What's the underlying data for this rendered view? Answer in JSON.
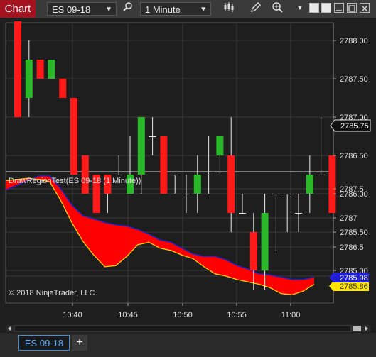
{
  "toolbar": {
    "chart_label": "Chart",
    "instrument": "ES 09-18",
    "interval": "1 Minute",
    "icons": [
      "search-icon",
      "bar-type-icon",
      "pencil-icon",
      "zoom-icon",
      "dropdown-icon",
      "window-tile-icon",
      "minimize-icon",
      "maximize-icon",
      "close-icon"
    ]
  },
  "price_panel": {
    "y_ticks": [
      "2788.00",
      "2787.50",
      "2787.00",
      "2786.50",
      "2786.00",
      "2785.50",
      "2785.00"
    ],
    "last_price_label": "2785.75"
  },
  "indicator_panel": {
    "title": "DrawRegionTest(ES 09-18 (1 Minute))",
    "y_ticks": [
      "2787.5",
      "2787",
      "2786.5",
      "2786"
    ],
    "blue_value_label": "2785.98",
    "yellow_value_label": "2785.86",
    "copyright": "© 2018 NinjaTrader, LLC"
  },
  "x_axis": {
    "ticks": [
      "10:40",
      "10:45",
      "10:50",
      "10:55",
      "11:00"
    ]
  },
  "status": {
    "tab_label": "ES 09-18",
    "add_tab_label": "+"
  },
  "colors": {
    "up": "#2ab82a",
    "down": "#ff1a1a",
    "region": "#ff0000",
    "blue_line": "#2222cc",
    "yellow_line": "#ffd200",
    "chart_tab": "#a3121f"
  },
  "chart_data": [
    {
      "type": "candlestick",
      "title": "ES 09-18",
      "x_axis": "time (1 minute)",
      "ylim": [
        2784.75,
        2788.25
      ],
      "candles": [
        {
          "o": 2788.25,
          "h": 2788.25,
          "l": 2787.0,
          "c": 2787.0
        },
        {
          "o": 2787.25,
          "h": 2788.0,
          "l": 2787.0,
          "c": 2787.75
        },
        {
          "o": 2787.75,
          "h": 2787.75,
          "l": 2787.5,
          "c": 2787.5
        },
        {
          "o": 2787.5,
          "h": 2787.75,
          "l": 2787.5,
          "c": 2787.75
        },
        {
          "o": 2787.5,
          "h": 2787.5,
          "l": 2787.25,
          "c": 2787.25
        },
        {
          "o": 2787.25,
          "h": 2787.25,
          "l": 2786.25,
          "c": 2786.25
        },
        {
          "o": 2786.5,
          "h": 2786.5,
          "l": 2786.0,
          "c": 2786.0
        },
        {
          "o": 2786.25,
          "h": 2786.25,
          "l": 2785.75,
          "c": 2785.75
        },
        {
          "o": 2786.25,
          "h": 2786.25,
          "l": 2785.75,
          "c": 2786.0
        },
        {
          "o": 2786.25,
          "h": 2786.5,
          "l": 2786.25,
          "c": 2786.25
        },
        {
          "o": 2786.0,
          "h": 2786.75,
          "l": 2786.0,
          "c": 2786.25
        },
        {
          "o": 2786.25,
          "h": 2787.0,
          "l": 2786.0,
          "c": 2787.0
        },
        {
          "o": 2786.75,
          "h": 2787.0,
          "l": 2786.5,
          "c": 2786.75
        },
        {
          "o": 2786.75,
          "h": 2786.75,
          "l": 2786.0,
          "c": 2786.0
        },
        {
          "o": 2786.25,
          "h": 2786.25,
          "l": 2786.0,
          "c": 2786.25
        },
        {
          "o": 2786.0,
          "h": 2786.25,
          "l": 2785.75,
          "c": 2786.0
        },
        {
          "o": 2786.0,
          "h": 2786.5,
          "l": 2785.75,
          "c": 2786.25
        },
        {
          "o": 2786.25,
          "h": 2786.75,
          "l": 2786.0,
          "c": 2786.25
        },
        {
          "o": 2786.5,
          "h": 2786.75,
          "l": 2786.25,
          "c": 2786.75
        },
        {
          "o": 2786.5,
          "h": 2787.0,
          "l": 2785.5,
          "c": 2785.75
        },
        {
          "o": 2785.75,
          "h": 2786.0,
          "l": 2785.75,
          "c": 2785.75
        },
        {
          "o": 2785.5,
          "h": 2785.75,
          "l": 2784.75,
          "c": 2785.0
        },
        {
          "o": 2785.0,
          "h": 2786.0,
          "l": 2784.75,
          "c": 2785.75
        },
        {
          "o": 2786.0,
          "h": 2786.0,
          "l": 2785.25,
          "c": 2786.0
        },
        {
          "o": 2786.0,
          "h": 2786.0,
          "l": 2785.5,
          "c": 2786.0
        },
        {
          "o": 2785.75,
          "h": 2786.0,
          "l": 2785.5,
          "c": 2785.75
        },
        {
          "o": 2786.0,
          "h": 2786.5,
          "l": 2785.75,
          "c": 2786.25
        },
        {
          "o": 2786.25,
          "h": 2787.0,
          "l": 2786.25,
          "c": 2786.25
        },
        {
          "o": 2786.5,
          "h": 2786.5,
          "l": 2785.75,
          "c": 2785.75
        }
      ]
    },
    {
      "type": "area",
      "title": "DrawRegionTest(ES 09-18 (1 Minute))",
      "ylim": [
        2785.75,
        2787.75
      ],
      "x": [
        0,
        2,
        4,
        6,
        8,
        10,
        12,
        14,
        16,
        18,
        20,
        22,
        24,
        26,
        28,
        30,
        32,
        34,
        36,
        38,
        40,
        42,
        44,
        46,
        48,
        50,
        52,
        54,
        56
      ],
      "series": [
        {
          "name": "blue",
          "values": [
            2787.48,
            2787.56,
            2787.64,
            2787.72,
            2787.72,
            2787.5,
            2787.22,
            2787.04,
            2786.98,
            2786.92,
            2786.88,
            2786.86,
            2786.8,
            2786.72,
            2786.62,
            2786.58,
            2786.48,
            2786.38,
            2786.34,
            2786.34,
            2786.28,
            2786.18,
            2786.12,
            2786.04,
            2786.02,
            2785.98,
            2785.94,
            2785.94,
            2785.98
          ]
        },
        {
          "name": "yellow",
          "values": [
            2787.64,
            2787.66,
            2787.68,
            2787.66,
            2787.62,
            2787.3,
            2786.92,
            2786.6,
            2786.36,
            2786.16,
            2786.18,
            2786.34,
            2786.54,
            2786.58,
            2786.48,
            2786.44,
            2786.36,
            2786.3,
            2786.16,
            2786.04,
            2786.0,
            2785.94,
            2785.9,
            2785.86,
            2785.8,
            2785.7,
            2785.68,
            2785.74,
            2785.86
          ]
        }
      ]
    }
  ]
}
